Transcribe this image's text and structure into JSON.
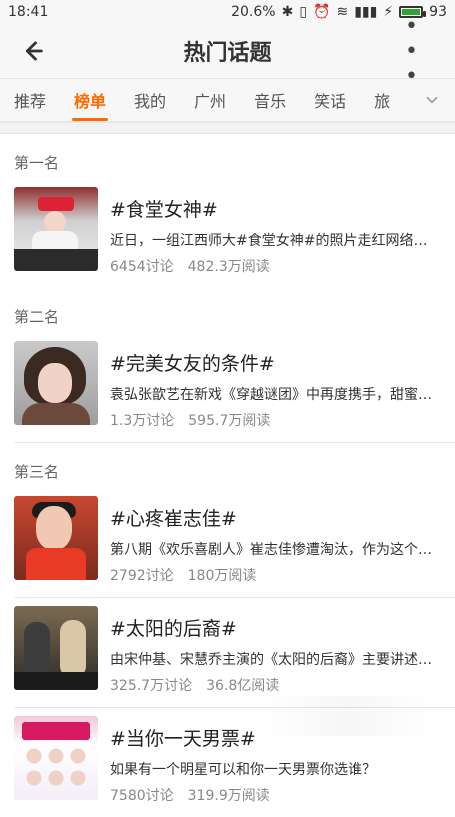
{
  "status": {
    "time": "18:41",
    "battery_text": "20.6%",
    "signal_text": "93"
  },
  "nav": {
    "title": "热门话题"
  },
  "tabs": [
    {
      "label": "推荐"
    },
    {
      "label": "榜单"
    },
    {
      "label": "我的"
    },
    {
      "label": "广州"
    },
    {
      "label": "音乐"
    },
    {
      "label": "笑话"
    },
    {
      "label": "旅"
    }
  ],
  "ranks": [
    {
      "rank_label": "第一名",
      "title": "#食堂女神#",
      "desc": "近日，一组江西师大#食堂女神#的照片走红网络，也…",
      "discussions": "6454讨论",
      "reads": "482.3万阅读"
    },
    {
      "rank_label": "第二名",
      "title": "#完美女友的条件#",
      "desc": "袁弘张歆艺在新戏《穿越谜团》中再度携手，甜蜜虐…",
      "discussions": "1.3万讨论",
      "reads": "595.7万阅读"
    },
    {
      "rank_label": "第三名",
      "title": "#心疼崔志佳#",
      "desc": "第八期《欢乐喜剧人》崔志佳惨遭淘汰，作为这个舞…",
      "discussions": "2792讨论",
      "reads": "180万阅读"
    }
  ],
  "more_topics": [
    {
      "title": "#太阳的后裔#",
      "desc": "由宋仲基、宋慧乔主演的《太阳的后裔》主要讲述了…",
      "discussions": "325.7万讨论",
      "reads": "36.8亿阅读"
    },
    {
      "title": "#当你一天男票#",
      "desc": "如果有一个明星可以和你一天男票你选谁？",
      "discussions": "7580讨论",
      "reads": "319.9万阅读"
    }
  ]
}
